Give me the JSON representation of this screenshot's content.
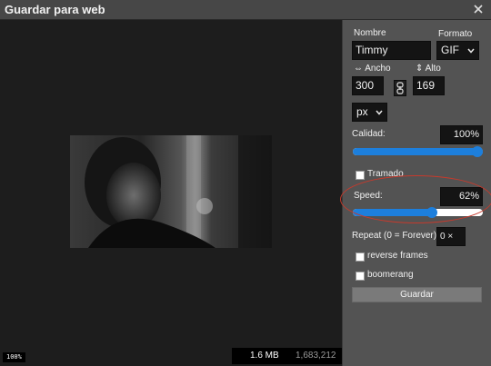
{
  "window": {
    "title": "Guardar para web"
  },
  "preview": {
    "zoom": "100%",
    "size_mb": "1.6 MB",
    "size_bytes": "1,683,212 B"
  },
  "panel": {
    "nombre": {
      "label": "Nombre",
      "value": "Timmy"
    },
    "formato": {
      "label": "Formato",
      "value": "GIF"
    },
    "ancho": {
      "label": "⇔ Ancho",
      "value": "300"
    },
    "alto": {
      "label": "⇕ Alto",
      "value": "169"
    },
    "unit": {
      "value": "px"
    },
    "calidad": {
      "label": "Calidad:",
      "value": "100%",
      "level": 1.0
    },
    "tramado": {
      "label": "Tramado",
      "checked": false
    },
    "speed": {
      "label": "Speed:",
      "value": "62%",
      "level": 0.62
    },
    "repeat": {
      "label": "Repeat (0 = Forever):",
      "value": "0 ×"
    },
    "reverse_frames": {
      "label": "reverse frames",
      "checked": false
    },
    "boomerang": {
      "label": "boomerang",
      "checked": false
    },
    "save_label": "Guardar"
  },
  "colors": {
    "accent": "#1d7fdc",
    "annotation": "#c73a2c",
    "panel": "#535353",
    "titlebar": "#474747"
  }
}
